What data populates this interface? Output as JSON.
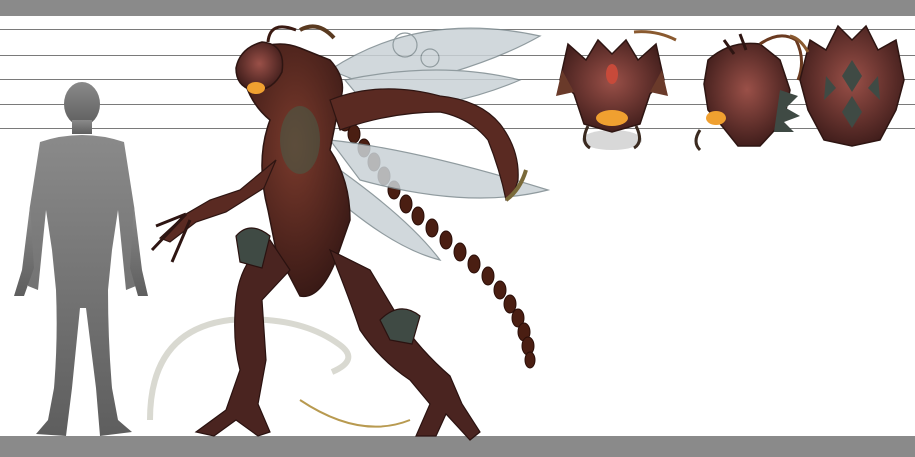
{
  "sheet": {
    "subject": "creature-turnaround",
    "views": [
      "human-scale-silhouette",
      "full-body",
      "head-front",
      "head-side",
      "head-back"
    ],
    "colors": {
      "band": "#8a8a8a",
      "scale_line": "#7a7a7a",
      "silhouette": "#777777",
      "body": "#5a2a22",
      "body_dark": "#2e1512",
      "armor": "#3f4a44",
      "wing": "#c9d2d6",
      "glow": "#f0a030",
      "tail_beads": "#4a1e12"
    }
  }
}
